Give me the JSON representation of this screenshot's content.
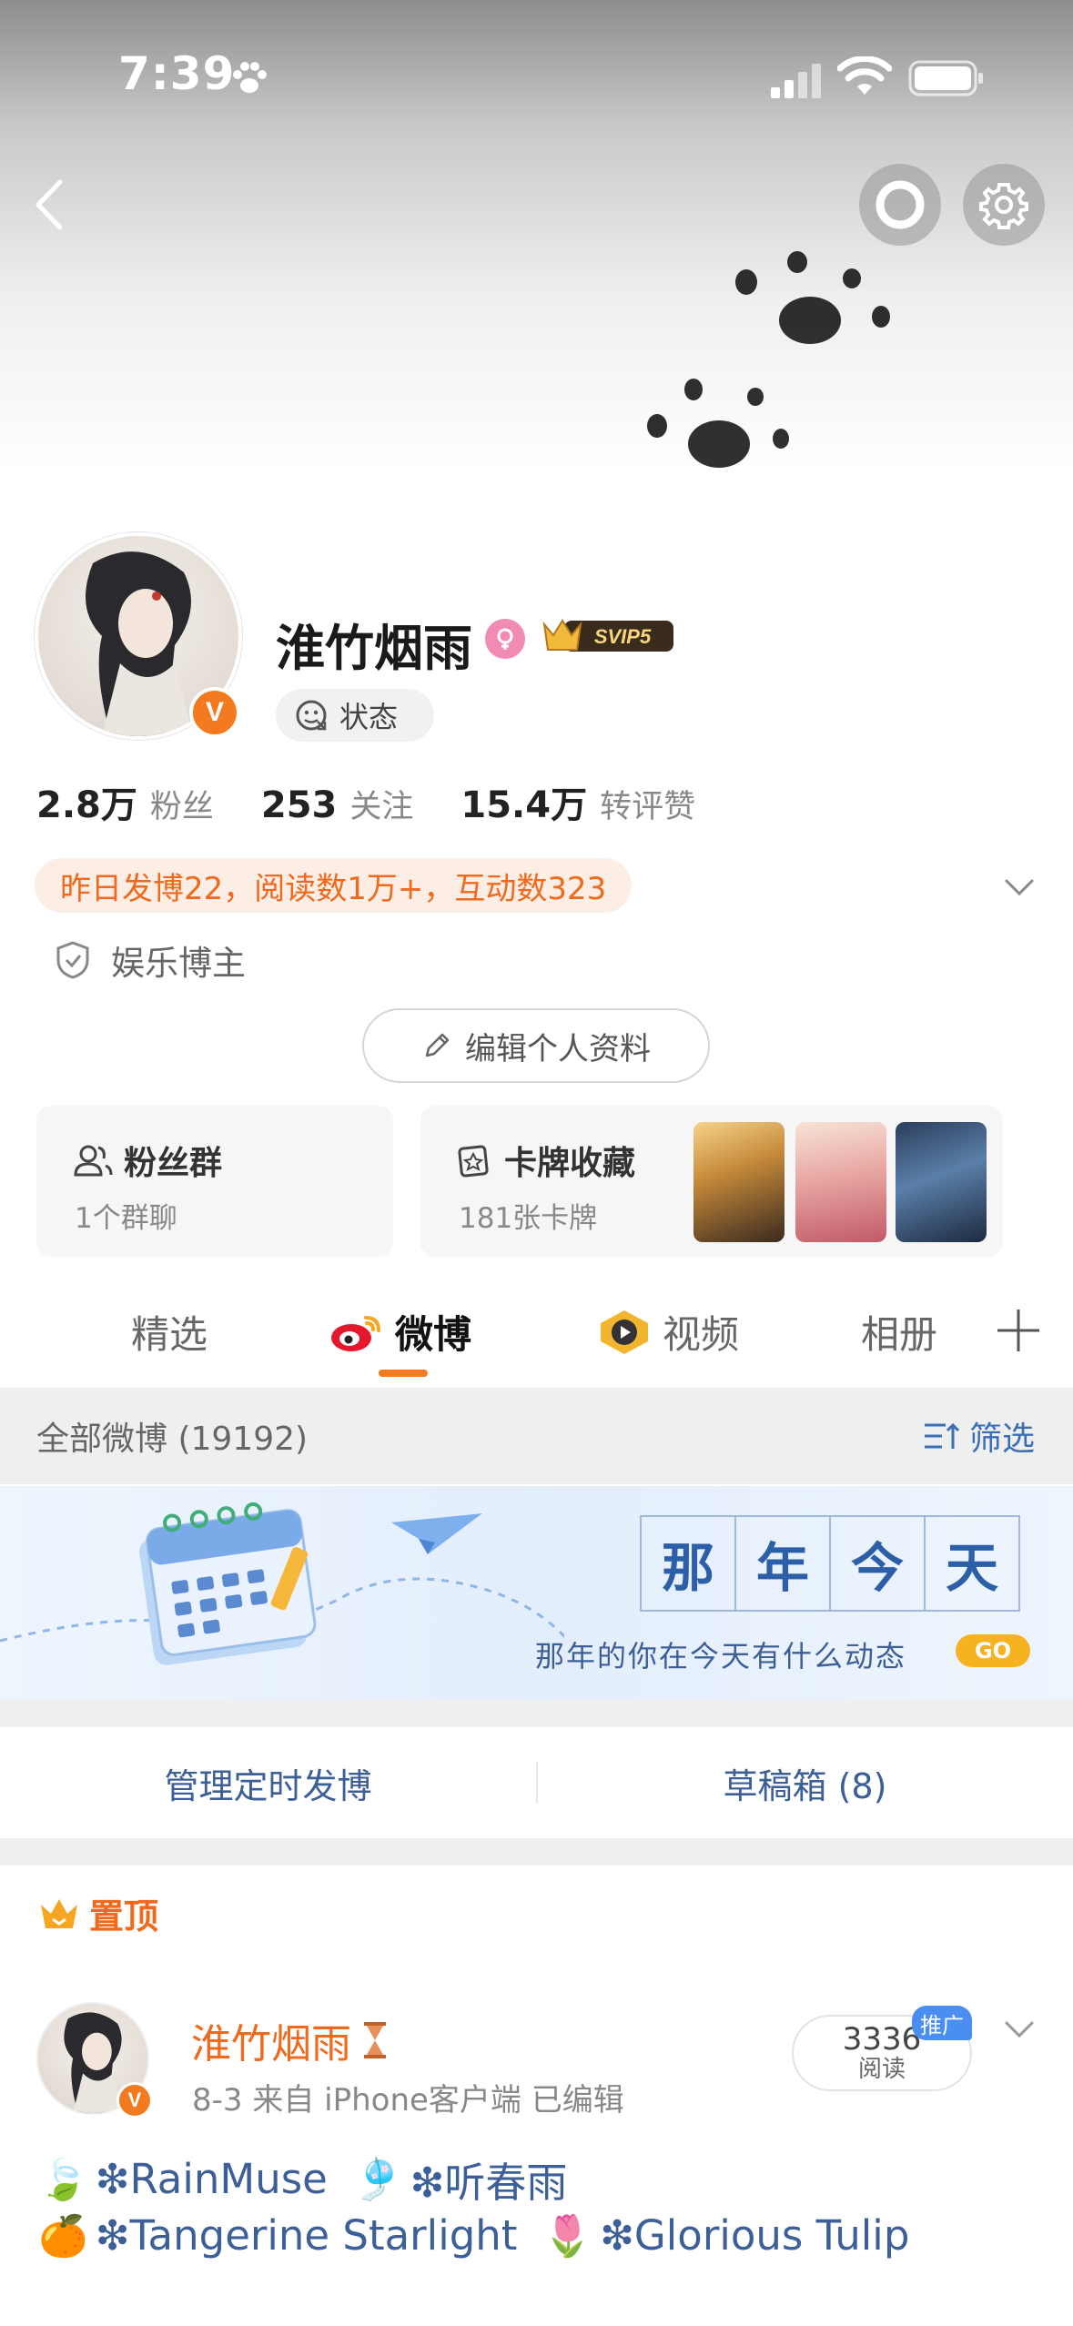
{
  "status_bar": {
    "time": "7:39"
  },
  "profile": {
    "name": "淮竹烟雨",
    "verified_badge": "V",
    "vip_badge": "SVIP5",
    "status_label": "状态",
    "stats": [
      {
        "num": "2.8万",
        "label": "粉丝"
      },
      {
        "num": "253",
        "label": "关注"
      },
      {
        "num": "15.4万",
        "label": "转评赞"
      }
    ],
    "summary": "昨日发博22，阅读数1万+，互动数323",
    "tag": "娱乐博主",
    "edit_button": "编辑个人资料"
  },
  "cards": {
    "fans": {
      "title": "粉丝群",
      "sub": "1个群聊"
    },
    "collect": {
      "title": "卡牌收藏",
      "sub": "181张卡牌"
    }
  },
  "tabs": [
    {
      "label": "精选"
    },
    {
      "label": "微博"
    },
    {
      "label": "视频"
    },
    {
      "label": "相册"
    }
  ],
  "filter_bar": {
    "label": "全部微博 (19192)",
    "filter": "筛选"
  },
  "banner": {
    "title_chars": [
      "那",
      "年",
      "今",
      "天"
    ],
    "subtitle": "那年的你在今天有什么动态",
    "go": "GO"
  },
  "manage": {
    "scheduled": "管理定时发博",
    "drafts": "草稿箱 (8)"
  },
  "pinned": {
    "label": "置顶",
    "author": "淮竹烟雨",
    "meta": "8-3  来自 iPhone客户端  已编辑",
    "reads_num": "3336",
    "reads_label": "阅读",
    "promo": "推广",
    "line1": [
      {
        "emoji": "🍃",
        "text": "❇RainMuse"
      },
      {
        "emoji": "🎐",
        "text": "❇听春雨"
      }
    ],
    "line2": [
      {
        "emoji": "🍊",
        "text": "❇Tangerine Starlight"
      },
      {
        "emoji": "🌷",
        "text": "❇Glorious Tulip"
      }
    ]
  },
  "colors": {
    "accent_orange": "#f0691d",
    "link_blue": "#3d5f97",
    "badge_orange": "#f37a1f"
  }
}
